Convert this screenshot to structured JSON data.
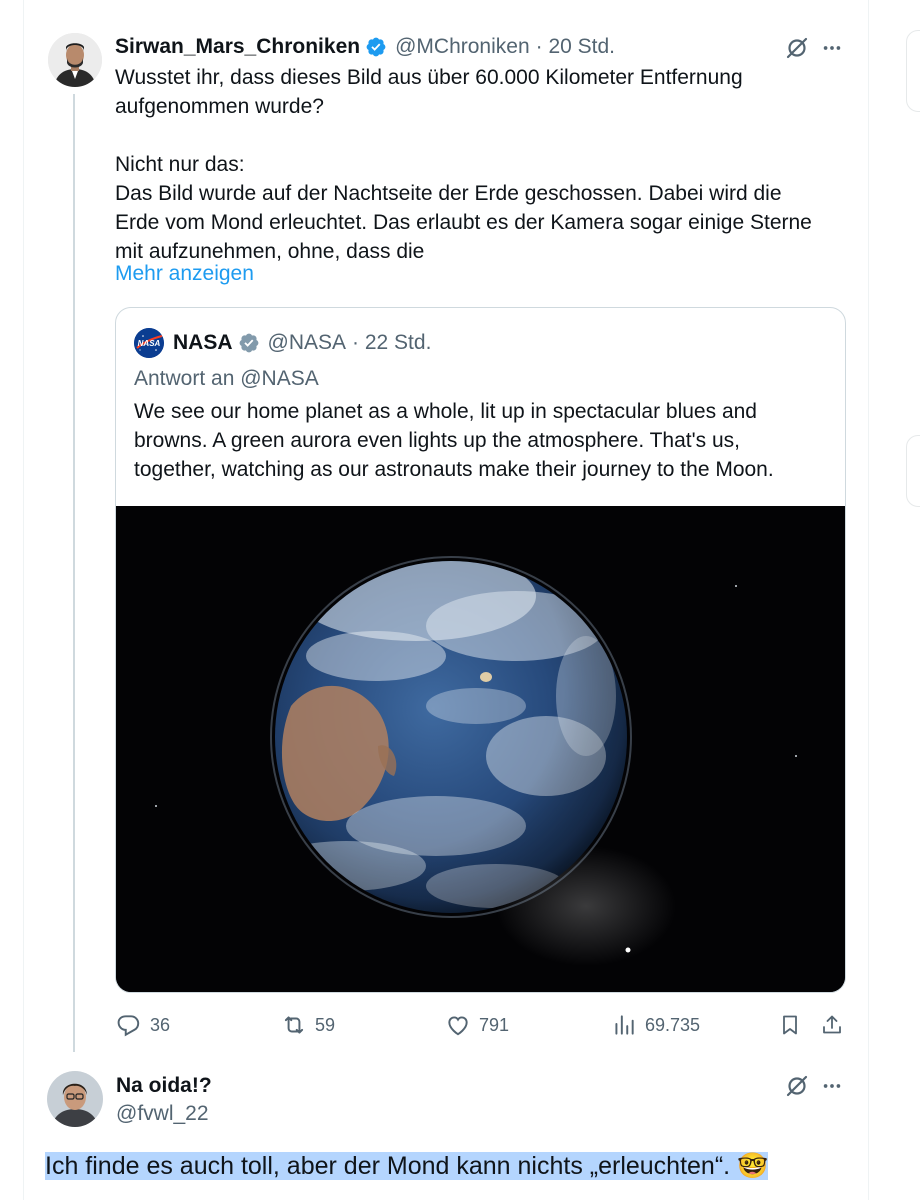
{
  "main_tweet": {
    "display_name": "Sirwan_Mars_Chroniken",
    "handle": "@MChroniken",
    "time": "· 20 Std.",
    "text_lines": [
      "Wusstet ihr, dass dieses Bild aus über 60.000 Kilometer Entfernung",
      "aufgenommen wurde?",
      "Nicht nur das:",
      "Das Bild wurde auf der Nachtseite der Erde geschossen. Dabei wird die",
      "Erde vom Mond erleuchtet. Das erlaubt es der Kamera sogar einige Sterne",
      "mit aufzunehmen, ohne, dass die"
    ],
    "show_more": "Mehr anzeigen"
  },
  "quoted_tweet": {
    "display_name": "NASA",
    "handle": "@NASA",
    "time": "· 22 Std.",
    "reply_to": "Antwort an @NASA",
    "text_lines": [
      "We see our home planet as a whole, lit up in spectacular blues and",
      "browns. A green aurora even lights up the atmosphere. That's us,",
      "together, watching as our astronauts make their journey to the Moon."
    ],
    "avatar_text": "NASA"
  },
  "actions": {
    "replies": "36",
    "reposts": "59",
    "likes": "791",
    "views": "69.735"
  },
  "reply_tweet": {
    "display_name": "Na oida!?",
    "handle": "@fvwl_22",
    "text": "Ich finde es auch toll, aber der Mond kann nichts „erleuchten“.",
    "emoji": "🤓"
  },
  "icons": [
    "verified-badge-icon",
    "grok-icon",
    "more-options-icon",
    "reply-icon",
    "repost-icon",
    "like-icon",
    "views-icon",
    "bookmark-icon",
    "share-icon"
  ],
  "colors": {
    "link": "#1d9bf0",
    "muted": "#536471",
    "verified": "#1d9bf0",
    "selection": "#b4d5fe"
  }
}
